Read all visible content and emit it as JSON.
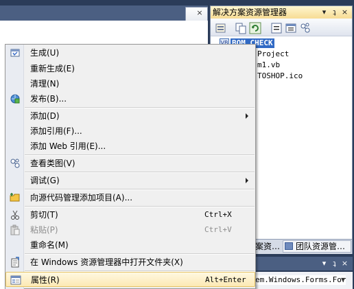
{
  "solution_explorer": {
    "title": "解决方案资源管理器",
    "title_buttons": [
      "▾",
      "ʇ",
      "×"
    ],
    "tree_items": [
      {
        "label": "BOM_CHECK",
        "selected": true
      },
      {
        "label": "Project"
      },
      {
        "label": "m1.vb"
      },
      {
        "label": "TOSHOP.ico"
      }
    ],
    "bottom_tabs": [
      "案资…",
      "团队资源管…"
    ]
  },
  "properties_panel": {
    "title_buttons": [
      "▾",
      "ʇ",
      "×"
    ],
    "combo_value": "em.Windows.Forms.For"
  },
  "doc_tab": {
    "close_glyph": "×"
  },
  "context_menu": {
    "items": [
      {
        "label": "生成(U)",
        "icon": "build-icon",
        "shortcut": "",
        "submenu": false,
        "disabled": false
      },
      {
        "label": "重新生成(E)",
        "icon": "",
        "shortcut": "",
        "submenu": false,
        "disabled": false
      },
      {
        "label": "清理(N)",
        "icon": "",
        "shortcut": "",
        "submenu": false,
        "disabled": false
      },
      {
        "label": "发布(B)...",
        "icon": "publish-icon",
        "shortcut": "",
        "submenu": false,
        "disabled": false
      },
      {
        "label": "添加(D)",
        "icon": "",
        "shortcut": "",
        "submenu": true,
        "disabled": false
      },
      {
        "label": "添加引用(F)...",
        "icon": "",
        "shortcut": "",
        "submenu": false,
        "disabled": false
      },
      {
        "label": "添加 Web 引用(E)...",
        "icon": "",
        "shortcut": "",
        "submenu": false,
        "disabled": false
      },
      {
        "label": "查看类图(V)",
        "icon": "class-diagram-icon",
        "shortcut": "",
        "submenu": false,
        "disabled": false
      },
      {
        "label": "调试(G)",
        "icon": "",
        "shortcut": "",
        "submenu": true,
        "disabled": false
      },
      {
        "label": "向源代码管理添加项目(A)...",
        "icon": "folder-add-icon",
        "shortcut": "",
        "submenu": false,
        "disabled": false
      },
      {
        "label": "剪切(T)",
        "icon": "scissors-icon",
        "shortcut": "Ctrl+X",
        "submenu": false,
        "disabled": false
      },
      {
        "label": "粘贴(P)",
        "icon": "paste-icon",
        "shortcut": "Ctrl+V",
        "submenu": false,
        "disabled": true
      },
      {
        "label": "重命名(M)",
        "icon": "",
        "shortcut": "",
        "submenu": false,
        "disabled": false
      },
      {
        "label": "在 Windows 资源管理器中打开文件夹(X)",
        "icon": "open-folder-icon",
        "shortcut": "",
        "submenu": false,
        "disabled": false
      },
      {
        "label": "属性(R)",
        "icon": "properties-icon",
        "shortcut": "Alt+Enter",
        "submenu": false,
        "disabled": false,
        "highlighted": true
      }
    ]
  },
  "colors": {
    "background": "#2b3c59",
    "menu_background": "#f0f0f0",
    "highlight": "#fce9b4",
    "selection": "#316ac5"
  }
}
